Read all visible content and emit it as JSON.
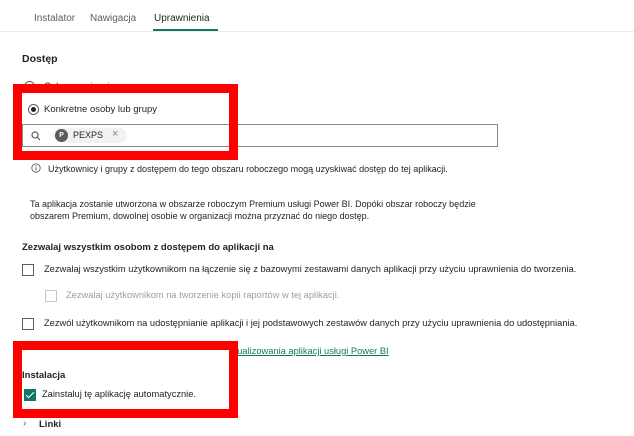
{
  "tabs": [
    {
      "label": "Instalator"
    },
    {
      "label": "Nawigacja"
    },
    {
      "label": "Uprawnienia"
    }
  ],
  "access": {
    "heading": "Dostęp",
    "option_hidden_label": "Cała organizacja",
    "option_specific_label": "Konkretne osoby lub grupy",
    "selected_person": {
      "initial": "P",
      "name": "PEXPS"
    },
    "info_text": "Użytkownicy i grupy z dostępem do tego obszaru roboczego mogą uzyskiwać dostęp do tej aplikacji.",
    "premium_note_line1": "Ta aplikacja zostanie utworzona w obszarze roboczym Premium usługi Power BI. Dopóki obszar roboczy będzie",
    "premium_note_line2": "obszarem Premium, dowolnej osobie w organizacji można przyznać do niego dostęp."
  },
  "allow_all": {
    "heading": "Zezwalaj wszystkim osobom z dostępem do aplikacji na",
    "opt_build": "Zezwalaj wszystkim użytkownikom na łączenie się z bazowymi zestawami danych aplikacji przy użyciu uprawnienia do tworzenia.",
    "opt_copy": "Zezwalaj użytkownikom na tworzenie kopii raportów w tej aplikacji.",
    "opt_share": "Zezwól użytkownikom na udostępnianie aplikacji i jej podstawowych zestawów danych przy użyciu uprawnienia do udostępniania.",
    "link_partial": "ktualizowania aplikacji usługi Power BI"
  },
  "install": {
    "heading": "Instalacja",
    "auto_install": "Zainstaluj tę aplikację automatycznie.",
    "auto_install_checked": true
  },
  "links_section": {
    "label": "Linki"
  },
  "colors": {
    "accent": "#117865",
    "highlight": "#ff0000"
  }
}
